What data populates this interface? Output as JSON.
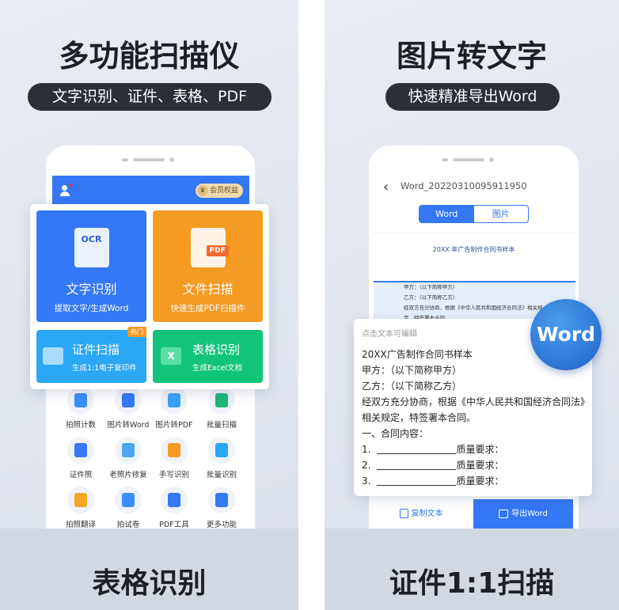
{
  "left": {
    "title": "多功能扫描仪",
    "subtitle": "文字识别、证件、表格、PDF",
    "bottom_title": "表格识别",
    "header": {
      "vip_label": "会员权益"
    },
    "tiles": [
      {
        "title": "文字识别",
        "sub": "提取文字/生成Word",
        "color": "#3478f6",
        "icon": "ocr-hand-icon",
        "icon_text": "OCR"
      },
      {
        "title": "文件扫描",
        "sub": "快速生成PDF扫描件",
        "color": "#f59a23",
        "icon": "pdf-scan-icon",
        "icon_text": "PDF"
      },
      {
        "title": "证件扫描",
        "sub": "生成1:1电子复印件",
        "color": "#2aa8f5",
        "icon": "id-card-icon",
        "badge": "热门"
      },
      {
        "title": "表格识别",
        "sub": "生成Excel文档",
        "color": "#12c47a",
        "icon": "excel-icon",
        "icon_text": "X"
      }
    ],
    "grid": [
      {
        "label": "拍照计数",
        "icon": "camera-count-icon",
        "color": "#3a8ef6"
      },
      {
        "label": "图片转Word",
        "icon": "word-doc-icon",
        "color": "#3478f6"
      },
      {
        "label": "图片转PDF",
        "icon": "image-pdf-icon",
        "color": "#3aa0f6"
      },
      {
        "label": "批量扫描",
        "icon": "batch-scan-icon",
        "color": "#1fb578"
      },
      {
        "label": "证件照",
        "icon": "id-photo-icon",
        "color": "#3478f6"
      },
      {
        "label": "老照片修复",
        "icon": "photo-restore-icon",
        "color": "#4aa6f0"
      },
      {
        "label": "手写识别",
        "icon": "handwriting-icon",
        "color": "#f59a23"
      },
      {
        "label": "批量识别",
        "icon": "batch-recognize-icon",
        "color": "#2aa8f5"
      },
      {
        "label": "拍照翻译",
        "icon": "translate-icon",
        "color": "#f5a623"
      },
      {
        "label": "拍试卷",
        "icon": "exam-paper-icon",
        "color": "#3a8ef6"
      },
      {
        "label": "PDF工具",
        "icon": "toolbox-icon",
        "color": "#3478f6"
      },
      {
        "label": "更多功能",
        "icon": "grid-icon",
        "color": "#3478f6"
      }
    ]
  },
  "right": {
    "title": "图片转文字",
    "subtitle": "快速精准导出Word",
    "bottom_title": "证件1:1扫描",
    "file_name": "Word_20220310095911950",
    "tabs": [
      "Word",
      "图片"
    ],
    "doc_title": "20XX 年广告制作合同书样本",
    "doc_preview": [
      "甲方：（以下简称甲方）",
      "乙方：（以下简称乙方）",
      "经双方充分协商，根据《中华人民共和国经济合同法》相关规",
      "定，特签署本合同。"
    ],
    "word_badge": "Word",
    "edit_hint": "点击文本可编辑",
    "edit_lines": [
      "20XX广告制作合同书样本",
      "甲方：（以下简称甲方）",
      "乙方：（以下简称乙方）",
      "经双方充分协商，根据《中华人民共和国经济合同法》",
      "相关规定，特签署本合同。",
      "一、合同内容："
    ],
    "items": [
      {
        "num": "1.",
        "label": "质量要求："
      },
      {
        "num": "2.",
        "label": "质量要求："
      },
      {
        "num": "3.",
        "label": "质量要求："
      }
    ],
    "copy_label": "复制文本",
    "export_label": "导出Word",
    "accent": "#3478f6"
  }
}
